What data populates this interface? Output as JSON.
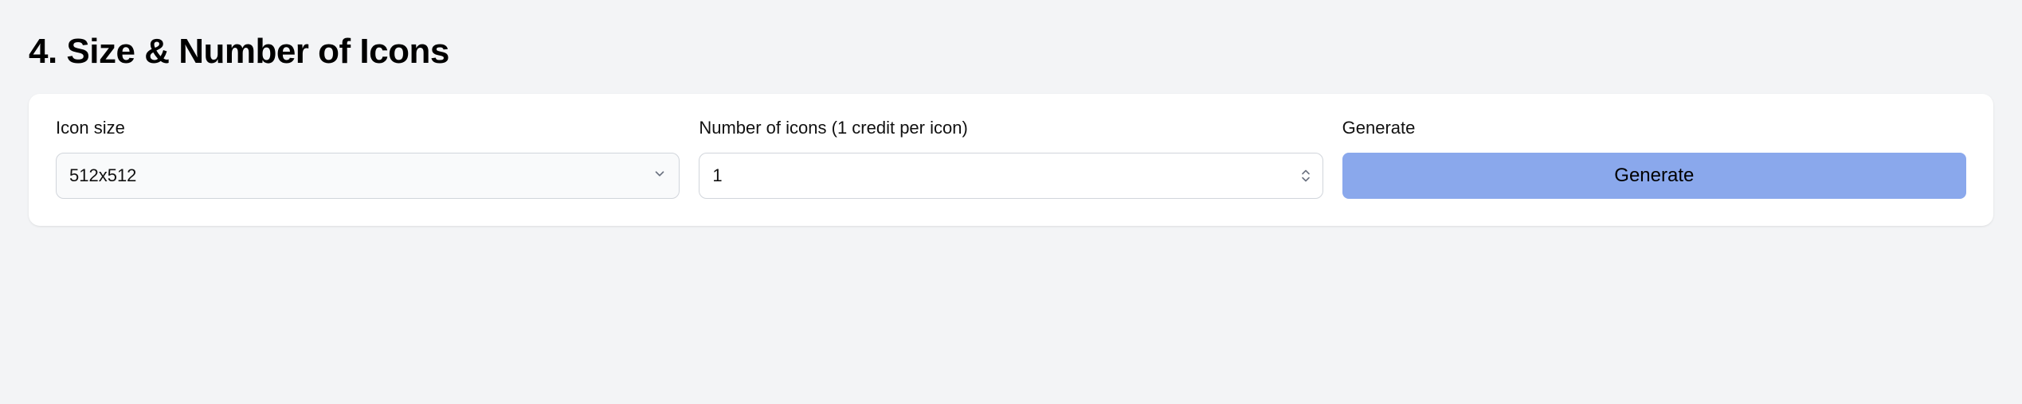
{
  "section": {
    "title": "4. Size & Number of Icons"
  },
  "form": {
    "iconSize": {
      "label": "Icon size",
      "value": "512x512"
    },
    "numberOfIcons": {
      "label": "Number of icons (1 credit per icon)",
      "value": "1"
    },
    "generate": {
      "label": "Generate",
      "buttonText": "Generate"
    }
  }
}
